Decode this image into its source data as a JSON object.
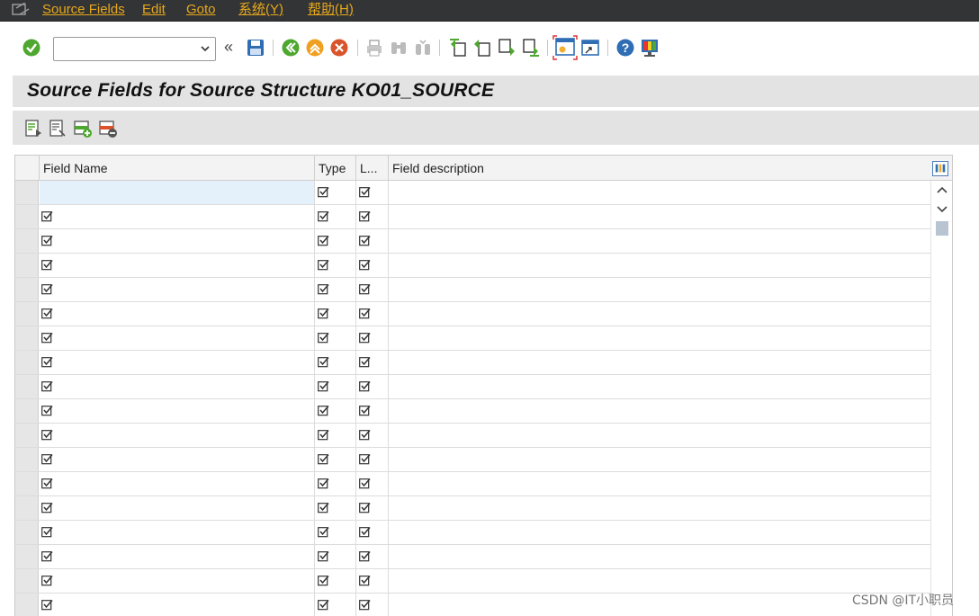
{
  "menu": {
    "items": [
      {
        "label": "Source Fields"
      },
      {
        "label": "Edit"
      },
      {
        "label": "Goto"
      },
      {
        "label": "系统(Y)"
      },
      {
        "label": "帮助(H)"
      }
    ]
  },
  "toolbar": {
    "command_field": {
      "value": "",
      "placeholder": ""
    },
    "collapse_label": "«"
  },
  "title": "Source Fields for Source Structure KO01_SOURCE",
  "table": {
    "columns": [
      {
        "label": "Field Name"
      },
      {
        "label": "Type"
      },
      {
        "label": "L..."
      },
      {
        "label": "Field description"
      }
    ]
  },
  "watermark": "CSDN @IT小职员",
  "colors": {
    "menu_text": "#e6a81c",
    "menu_bg": "#333435",
    "title_bg": "#e3e3e3",
    "active_cell": "#e4f1fb"
  },
  "icons": {
    "toolbar": [
      "enter-icon",
      "save-icon",
      "back-icon",
      "exit-icon",
      "cancel-icon",
      "print-icon",
      "find-icon",
      "find-next-icon",
      "first-page-icon",
      "previous-page-icon",
      "next-page-icon",
      "last-page-icon",
      "create-session-icon",
      "generate-shortcut-icon",
      "help-icon",
      "layout-icon"
    ],
    "app_toolbar": [
      "detail-icon",
      "display-icon",
      "insert-row-icon",
      "delete-row-icon"
    ]
  }
}
